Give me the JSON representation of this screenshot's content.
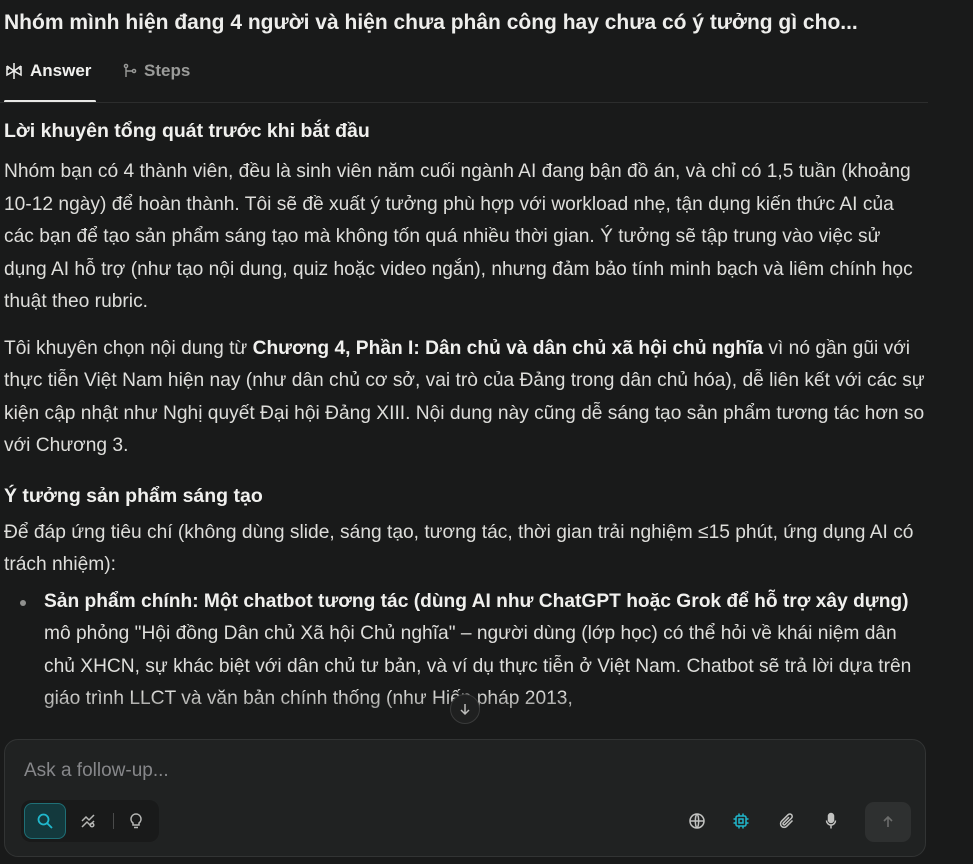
{
  "thread": {
    "title": "Nhóm mình hiện đang 4 người và hiện chưa phân công hay chưa có ý tưởng gì cho..."
  },
  "tabs": {
    "answer_label": "Answer",
    "steps_label": "Steps"
  },
  "answer": {
    "heading_1": "Lời khuyên tổng quát trước khi bắt đầu",
    "para_1": "Nhóm bạn có 4 thành viên, đều là sinh viên năm cuối ngành AI đang bận đồ án, và chỉ có 1,5 tuần (khoảng 10-12 ngày) để hoàn thành. Tôi sẽ đề xuất ý tưởng phù hợp với workload nhẹ, tận dụng kiến thức AI của các bạn để tạo sản phẩm sáng tạo mà không tốn quá nhiều thời gian. Ý tưởng sẽ tập trung vào việc sử dụng AI hỗ trợ (như tạo nội dung, quiz hoặc video ngắn), nhưng đảm bảo tính minh bạch và liêm chính học thuật theo rubric.",
    "para_2_prefix": "Tôi khuyên chọn nội dung từ ",
    "para_2_bold": "Chương 4, Phần I: Dân chủ và dân chủ xã hội chủ nghĩa",
    "para_2_suffix": " vì nó gần gũi với thực tiễn Việt Nam hiện nay (như dân chủ cơ sở, vai trò của Đảng trong dân chủ hóa), dễ liên kết với các sự kiện cập nhật như Nghị quyết Đại hội Đảng XIII. Nội dung này cũng dễ sáng tạo sản phẩm tương tác hơn so với Chương 3.",
    "heading_2": "Ý tưởng sản phẩm sáng tạo",
    "para_3": "Để đáp ứng tiêu chí (không dùng slide, sáng tạo, tương tác, thời gian trải nghiệm ≤15 phút, ứng dụng AI có trách nhiệm):",
    "bullet_1_bold": "Sản phẩm chính: Một chatbot tương tác (dùng AI như ChatGPT hoặc Grok để hỗ trợ xây dựng)",
    "bullet_1_text": " mô phỏng \"Hội đồng Dân chủ Xã hội Chủ nghĩa\" – người dùng (lớp học) có thể hỏi về khái niệm dân chủ XHCN, sự khác biệt với dân chủ tư bản, và ví dụ thực tiễn ở Việt Nam. Chatbot sẽ trả lời dựa trên giáo trình LLCT và văn bản chính thống (như Hiến pháp 2013,"
  },
  "composer": {
    "placeholder": "Ask a follow-up..."
  },
  "icons": {
    "answer_tab": "logo-icon",
    "steps_tab": "steps-icon",
    "scroll": "arrow-down-icon",
    "search_mode": "search-icon",
    "research_mode": "research-icon",
    "labs_mode": "lightbulb-icon",
    "globe": "globe-icon",
    "chip": "chip-icon",
    "attach": "paperclip-icon",
    "mic": "microphone-icon",
    "send": "arrow-up-icon"
  },
  "colors": {
    "background": "#191a1a",
    "accent": "#20b8cd",
    "text": "#dededb"
  }
}
